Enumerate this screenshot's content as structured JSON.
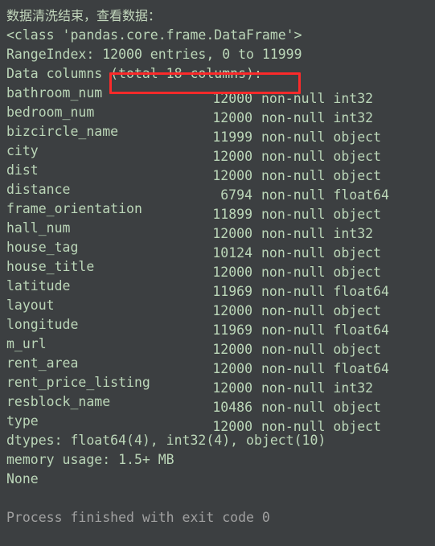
{
  "console": {
    "background_color": "#3c3f41",
    "text_color": "#bbd6b8",
    "dim_text_color": "#a0a0a0",
    "annotation_color": "#fb2a2a",
    "status_line": "数据清洗结束，查看数据：",
    "class_line": "<class 'pandas.core.frame.DataFrame'>",
    "range_index_line": "RangeIndex: 12000 entries, 0 to 11999",
    "data_columns_line": "Data columns (total 18 columns):",
    "data_columns_prefix": "Data columns ",
    "highlighted_text": "(total 18 columns):",
    "dtypes_line": "dtypes: float64(4), int32(4), object(10)",
    "memory_usage_line": "memory usage: 1.5+ MB",
    "none_line": "None",
    "process_finished_line": "Process finished with exit code 0"
  },
  "dataframe": {
    "total_columns": 18,
    "entries": 12000,
    "index_range": "0 to 11999",
    "columns": [
      {
        "name": "bathroom_num",
        "count": "12000",
        "null_label": "non-null",
        "dtype": "int32"
      },
      {
        "name": "bedroom_num",
        "count": "12000",
        "null_label": "non-null",
        "dtype": "int32"
      },
      {
        "name": "bizcircle_name",
        "count": "11999",
        "null_label": "non-null",
        "dtype": "object"
      },
      {
        "name": "city",
        "count": "12000",
        "null_label": "non-null",
        "dtype": "object"
      },
      {
        "name": "dist",
        "count": "12000",
        "null_label": "non-null",
        "dtype": "object"
      },
      {
        "name": "distance",
        "count": "6794",
        "null_label": "non-null",
        "dtype": "float64"
      },
      {
        "name": "frame_orientation",
        "count": "11899",
        "null_label": "non-null",
        "dtype": "object"
      },
      {
        "name": "hall_num",
        "count": "12000",
        "null_label": "non-null",
        "dtype": "int32"
      },
      {
        "name": "house_tag",
        "count": "10124",
        "null_label": "non-null",
        "dtype": "object"
      },
      {
        "name": "house_title",
        "count": "12000",
        "null_label": "non-null",
        "dtype": "object"
      },
      {
        "name": "latitude",
        "count": "11969",
        "null_label": "non-null",
        "dtype": "float64"
      },
      {
        "name": "layout",
        "count": "12000",
        "null_label": "non-null",
        "dtype": "object"
      },
      {
        "name": "longitude",
        "count": "11969",
        "null_label": "non-null",
        "dtype": "float64"
      },
      {
        "name": "m_url",
        "count": "12000",
        "null_label": "non-null",
        "dtype": "object"
      },
      {
        "name": "rent_area",
        "count": "12000",
        "null_label": "non-null",
        "dtype": "float64"
      },
      {
        "name": "rent_price_listing",
        "count": "12000",
        "null_label": "non-null",
        "dtype": "int32"
      },
      {
        "name": "resblock_name",
        "count": "10486",
        "null_label": "non-null",
        "dtype": "object"
      },
      {
        "name": "type",
        "count": "12000",
        "null_label": "non-null",
        "dtype": "object"
      }
    ]
  }
}
